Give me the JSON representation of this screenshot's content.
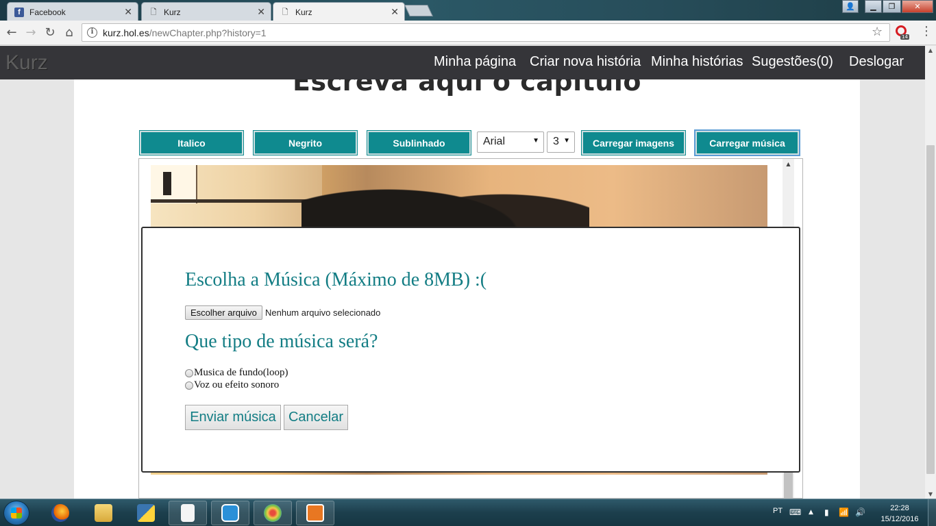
{
  "browser": {
    "tabs": [
      {
        "title": "Facebook",
        "favicon": "facebook-icon",
        "active": false
      },
      {
        "title": "Kurz",
        "favicon": "page-icon",
        "active": false
      },
      {
        "title": "Kurz",
        "favicon": "page-icon",
        "active": true
      }
    ],
    "url_host": "kurz.hol.es",
    "url_path": "/newChapter.php?history=1",
    "extension_badge": "14"
  },
  "site": {
    "brand": "Kurz",
    "nav": {
      "my_page": "Minha página",
      "new_story": "Criar nova história",
      "my_stories": "Minha histórias",
      "suggestions": "Sugestões(0)",
      "logout": "Deslogar"
    },
    "heading": "Escreva aqui o capítulo",
    "toolbar": {
      "italic": "Italico",
      "bold": "Negrito",
      "underline": "Sublinhado",
      "font_family": "Arial",
      "font_size": "3",
      "upload_images": "Carregar imagens",
      "upload_music": "Carregar música"
    }
  },
  "modal": {
    "title": "Escolha a Música (Máximo de 8MB) :(",
    "file_button": "Escolher arquivo",
    "file_status": "Nenhum arquivo selecionado",
    "type_question": "Que tipo de música será?",
    "options": [
      {
        "label": "Musica de fundo(loop)",
        "checked": false
      },
      {
        "label": "Voz ou efeito sonoro",
        "checked": false
      }
    ],
    "submit": "Enviar música",
    "cancel": "Cancelar"
  },
  "taskbar": {
    "language": "PT",
    "time": "22:28",
    "date": "15/12/2016"
  },
  "colors": {
    "teal_button": "#0f8a8f",
    "modal_text": "#137d84",
    "nav_bg": "#353539"
  }
}
